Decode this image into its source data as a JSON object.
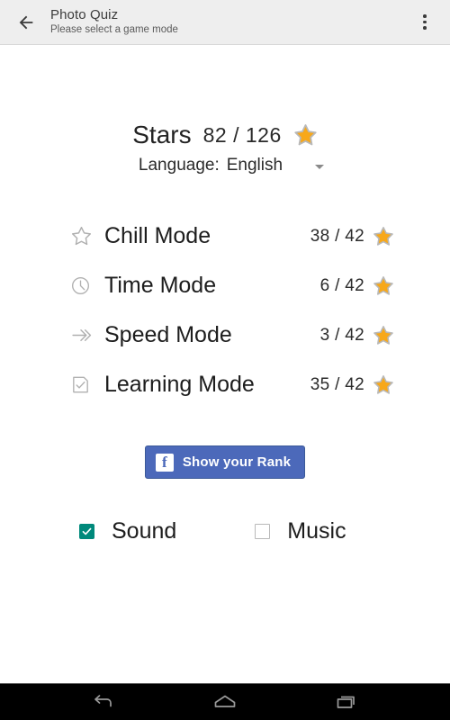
{
  "appbar": {
    "back_icon": "back-arrow-icon",
    "title": "Photo Quiz",
    "subtitle": "Please select a game mode",
    "overflow_icon": "overflow-menu-icon"
  },
  "stars": {
    "label": "Stars",
    "score": "82 / 126",
    "star_icon": "star-icon"
  },
  "language": {
    "label": "Language:",
    "value": "English",
    "caret_icon": "chevron-down-icon"
  },
  "modes": [
    {
      "icon": "star-outline-icon",
      "name": "Chill Mode",
      "score": "38 / 42",
      "star_icon": "star-icon"
    },
    {
      "icon": "clock-icon",
      "name": "Time Mode",
      "score": "6 / 42",
      "star_icon": "star-icon"
    },
    {
      "icon": "double-arrow-icon",
      "name": "Speed Mode",
      "score": "3 / 42",
      "star_icon": "star-icon"
    },
    {
      "icon": "note-check-icon",
      "name": "Learning Mode",
      "score": "35 / 42",
      "star_icon": "star-icon"
    }
  ],
  "facebook_button": {
    "icon": "facebook-icon",
    "glyph": "f",
    "label": "Show your Rank",
    "background_color": "#4c69ba"
  },
  "toggles": [
    {
      "name": "sound",
      "label": "Sound",
      "checked": true,
      "color": "#00897b"
    },
    {
      "name": "music",
      "label": "Music",
      "checked": false,
      "color": "#b9b9b9"
    }
  ],
  "navbar": {
    "back_icon": "nav-back-icon",
    "home_icon": "nav-home-icon",
    "recents_icon": "nav-recents-icon"
  },
  "colors": {
    "appbar_background": "#eeeeee",
    "page_background": "#ffffff",
    "accent": "#00897b",
    "star_fill": "#f5a623",
    "navbar_background": "#000000"
  }
}
